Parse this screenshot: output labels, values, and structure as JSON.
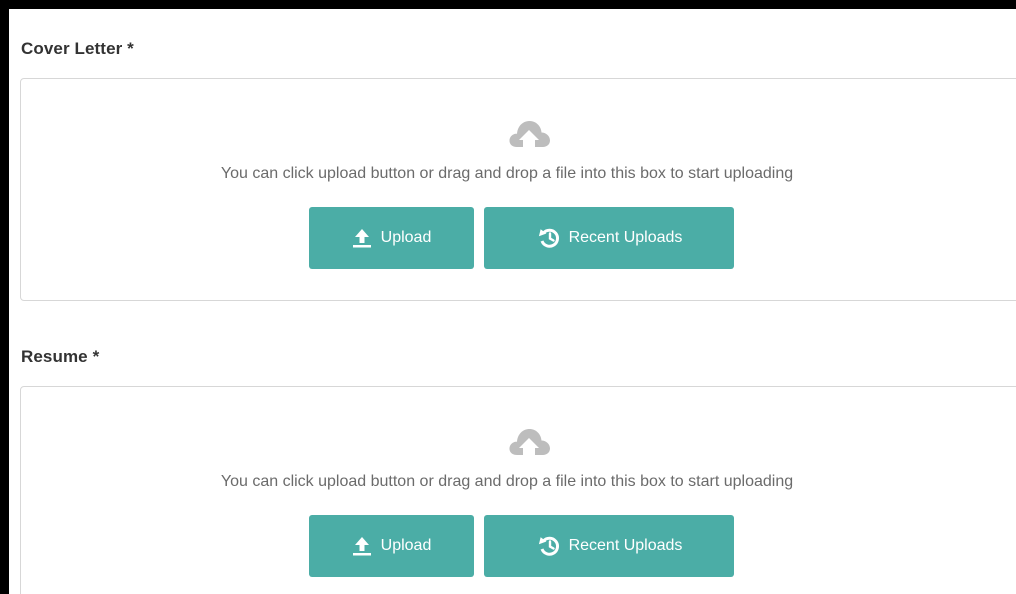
{
  "cover_letter": {
    "label": "Cover Letter *",
    "hint": "You can click upload button or drag and drop a file into this box to start uploading",
    "upload_label": "Upload",
    "recent_label": "Recent Uploads"
  },
  "resume": {
    "label": "Resume *",
    "hint": "You can click upload button or drag and drop a file into this box to start uploading",
    "upload_label": "Upload",
    "recent_label": "Recent Uploads"
  },
  "colors": {
    "button": "#4bada6",
    "cloud_icon": "#bdbdbd",
    "hint_text": "#6b6b6b",
    "label_text": "#333333"
  },
  "icons": {
    "cloud": "cloud-upload-icon",
    "upload": "upload-arrow-icon",
    "recent": "history-icon"
  }
}
